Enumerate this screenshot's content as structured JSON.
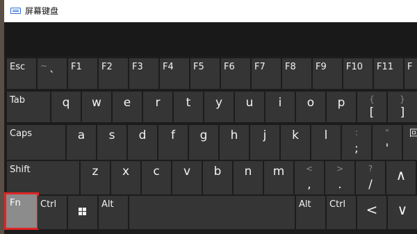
{
  "window": {
    "title": "屏幕键盘",
    "icon": "keyboard-icon"
  },
  "rows": {
    "row1": {
      "esc": "Esc",
      "backtick_sec": "~",
      "backtick_main": "`",
      "f1": "F1",
      "f2": "F2",
      "f3": "F3",
      "f4": "F4",
      "f5": "F5",
      "f6": "F6",
      "f7": "F7",
      "f8": "F8",
      "f9": "F9",
      "f10": "F10",
      "f11": "F11",
      "f12": "F"
    },
    "row2": {
      "tab": "Tab",
      "q": "q",
      "w": "w",
      "e": "e",
      "r": "r",
      "t": "t",
      "y": "y",
      "u": "u",
      "i": "i",
      "o": "o",
      "p": "p",
      "lbracket_sec": "{",
      "lbracket_main": "[",
      "rbracket_sec": "}",
      "rbracket_main": "]"
    },
    "row3": {
      "caps": "Caps",
      "a": "a",
      "s": "s",
      "d": "d",
      "f": "f",
      "g": "g",
      "h": "h",
      "j": "j",
      "k": "k",
      "l": "l",
      "semicolon_sec": ":",
      "semicolon_main": ";",
      "quote_sec": "\"",
      "quote_main": "'",
      "extra_partial": "回"
    },
    "row4": {
      "shift": "Shift",
      "z": "z",
      "x": "x",
      "c": "c",
      "v": "v",
      "b": "b",
      "n": "n",
      "m": "m",
      "comma_sec": "<",
      "comma_main": ",",
      "period_sec": ">",
      "period_main": ".",
      "slash_sec": "?",
      "slash_main": "/",
      "up_arrow": "∧"
    },
    "row5": {
      "fn": "Fn",
      "ctrl": "Ctrl",
      "win": "windows-logo-icon",
      "alt": "Alt",
      "alt_right": "Alt",
      "ctrl_right": "Ctrl",
      "left_arrow": "<",
      "down_arrow": "∨"
    }
  },
  "highlight": {
    "key": "Fn",
    "border_color": "#e02626",
    "fill_color": "#8c8c8c"
  }
}
